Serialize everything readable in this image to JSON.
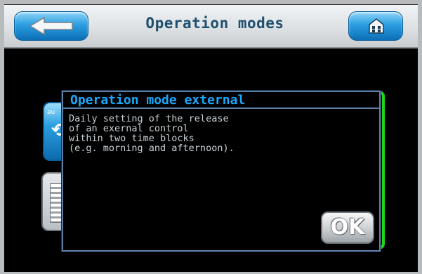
{
  "header": {
    "title": "Operation modes",
    "back_icon": "back-arrow-icon",
    "home_icon": "home-icon"
  },
  "dialog": {
    "title": "Operation mode external",
    "body_lines": [
      "Daily setting of the release",
      "of an exernal control",
      "within two time blocks",
      "(e.g. morning and afternoon)."
    ],
    "ok_label": "OK"
  },
  "colors": {
    "title_text": "#1f4f6e",
    "dialog_title": "#1aa9ff",
    "dialog_border": "#5b7fa6",
    "accent_blue": "#2c9ee2",
    "highlight_green": "#1fd61f"
  }
}
